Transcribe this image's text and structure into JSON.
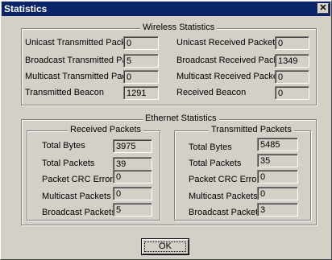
{
  "window": {
    "title": "Statistics",
    "close_glyph": "✕"
  },
  "wireless": {
    "title": "Wireless Statistics",
    "left": [
      {
        "label": "Unicast Transmitted Packets",
        "value": "0"
      },
      {
        "label": "Broadcast Transmitted Packets",
        "value": "5"
      },
      {
        "label": "Multicast Transmitted Packets",
        "value": "0"
      },
      {
        "label": "Transmitted Beacon",
        "value": "1291"
      }
    ],
    "right": [
      {
        "label": "Unicast Received Packets",
        "value": "0"
      },
      {
        "label": "Broadcast Received Packets",
        "value": "1349"
      },
      {
        "label": "Multicast Received Packets",
        "value": "0"
      },
      {
        "label": "Received Beacon",
        "value": "0"
      }
    ]
  },
  "ethernet": {
    "title": "Ethernet Statistics",
    "received": {
      "title": "Received Packets",
      "rows": [
        {
          "label": "Total Bytes",
          "value": "3975"
        },
        {
          "label": "Total Packets",
          "value": "39"
        },
        {
          "label": "Packet CRC Errors",
          "value": "0"
        },
        {
          "label": "Multicast Packets",
          "value": "0"
        },
        {
          "label": "Broadcast Packets",
          "value": "5"
        }
      ]
    },
    "transmitted": {
      "title": "Transmitted Packets",
      "rows": [
        {
          "label": "Total Bytes",
          "value": "5485"
        },
        {
          "label": "Total Packets",
          "value": "35"
        },
        {
          "label": "Packet CRC Errors",
          "value": "0"
        },
        {
          "label": "Multicast Packets",
          "value": "0"
        },
        {
          "label": "Broadcast Packets",
          "value": "3"
        }
      ]
    }
  },
  "ok_label": "OK"
}
